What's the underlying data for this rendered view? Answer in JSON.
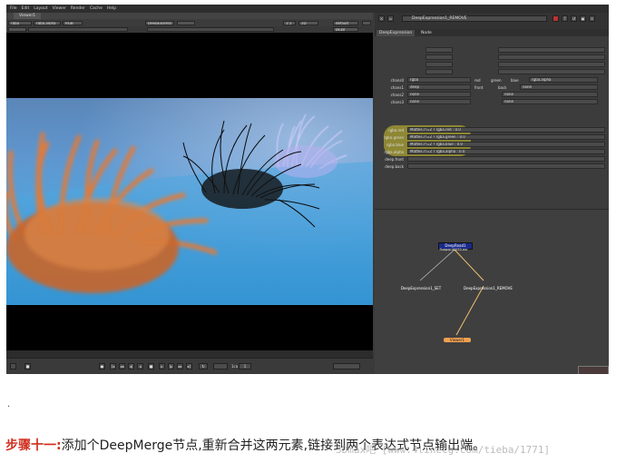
{
  "viewer": {
    "menu": [
      "File",
      "Edit",
      "Layout",
      "Viewer",
      "Render",
      "Cache",
      "Help"
    ],
    "tab": "Viewer1",
    "toolbar": {
      "channels": "rgba",
      "layer": "rgba.alpha",
      "colorspace": "RGB",
      "input": "DeepExpress",
      "zoom": "1:1",
      "view": "2D",
      "lut": "default",
      "format": "pk38"
    },
    "status": "1919x1079 bbox: 0 0 1920 1080 channels: rgba,depth,deep.Mattes",
    "frame_label": "1ca",
    "frame": "1"
  },
  "properties": {
    "node_name": "DeepExpression1_REMOVE",
    "tabs": [
      "DeepExpression",
      "Node"
    ],
    "rows": [
      {
        "label": "chans0",
        "value": "rgba",
        "channels": [
          "red",
          "green",
          "blue",
          "rgba.alpha"
        ]
      },
      {
        "label": "chans1",
        "value": "deep",
        "channels": [
          "front",
          "back"
        ],
        "extra": "none"
      },
      {
        "label": "chans2",
        "value": "none",
        "extra": "none"
      },
      {
        "label": "chans3",
        "value": "none",
        "extra": "none"
      }
    ],
    "expressions": [
      {
        "label": "rgba.red",
        "value": "Mattes.r!=2 ? rgba.red : 0.0"
      },
      {
        "label": "rgba.green",
        "value": "Mattes.r!=2 ? rgba.green : 0.0"
      },
      {
        "label": "rgba.blue",
        "value": "Mattes.r!=2 ? rgba.blue : 0.0"
      },
      {
        "label": "rgba.alpha",
        "value": "Mattes.r!=2 ? rgba.alpha : 0.0"
      }
    ],
    "deep": [
      {
        "label": "deep.front",
        "value": ""
      },
      {
        "label": "deep.back",
        "value": ""
      }
    ]
  },
  "nodegraph": {
    "read_node": "DeepRead1",
    "read_file": "fluepoint0050.exr",
    "set_node": "DeepExpression1_SET",
    "remove_node": "DeepExpression1_REMOVE",
    "viewer_node": "Viewer1"
  },
  "article": {
    "bullet": ".",
    "step_label": "步骤十一:",
    "text": "添加个DeepMerge节点,重新合并这两元素,链接到两个表达式节点输出端。",
    "watermark": "3Dmax吧 [www.4linecg.com/tieba/1771]"
  },
  "colors": {
    "accent_red": "#d03020",
    "highlight": "#aaa032",
    "deepread_node": "#1a2a8a",
    "viewer_node": "#f0a050"
  }
}
